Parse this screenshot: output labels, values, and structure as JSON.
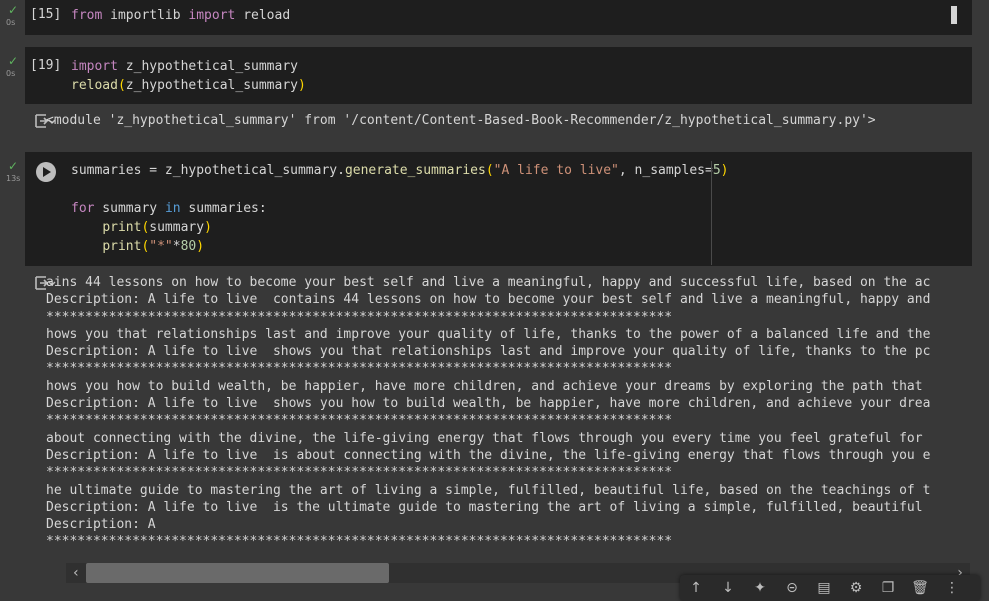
{
  "cells": [
    {
      "prompt": "[15]",
      "time": "0s",
      "lines": [
        [
          {
            "t": "from",
            "c": "kw"
          },
          {
            "t": " importlib ",
            "c": ""
          },
          {
            "t": "import",
            "c": "kw"
          },
          {
            "t": " reload",
            "c": ""
          }
        ]
      ]
    },
    {
      "prompt": "[19]",
      "time": "0s",
      "lines": [
        [
          {
            "t": "import",
            "c": "kw"
          },
          {
            "t": " z_hypothetical_summary",
            "c": ""
          }
        ],
        [
          {
            "t": "reload",
            "c": "fn"
          },
          {
            "t": "(",
            "c": "paren"
          },
          {
            "t": "z_hypothetical_summary",
            "c": ""
          },
          {
            "t": ")",
            "c": "paren"
          }
        ]
      ],
      "output": "<module 'z_hypothetical_summary' from '/content/Content-Based-Book-Recommender/z_hypothetical_summary.py'>"
    },
    {
      "time": "13s",
      "lines": [
        [
          {
            "t": "summaries = z_hypothetical_summary.",
            "c": ""
          },
          {
            "t": "generate_summaries",
            "c": "fn"
          },
          {
            "t": "(",
            "c": "paren"
          },
          {
            "t": "\"A life to live\"",
            "c": "str"
          },
          {
            "t": ", n_samples=",
            "c": ""
          },
          {
            "t": "5",
            "c": "num"
          },
          {
            "t": ")",
            "c": "paren"
          }
        ],
        [],
        [
          {
            "t": "for",
            "c": "kw"
          },
          {
            "t": " summary ",
            "c": ""
          },
          {
            "t": "in",
            "c": "kwb"
          },
          {
            "t": " summaries:",
            "c": ""
          }
        ],
        [
          {
            "t": "    ",
            "c": ""
          },
          {
            "t": "print",
            "c": "fn"
          },
          {
            "t": "(",
            "c": "paren"
          },
          {
            "t": "summary",
            "c": ""
          },
          {
            "t": ")",
            "c": "paren"
          }
        ],
        [
          {
            "t": "    ",
            "c": ""
          },
          {
            "t": "print",
            "c": "fn"
          },
          {
            "t": "(",
            "c": "paren"
          },
          {
            "t": "\"*\"",
            "c": "str"
          },
          {
            "t": "*",
            "c": ""
          },
          {
            "t": "80",
            "c": "num"
          },
          {
            "t": ")",
            "c": "paren"
          }
        ]
      ],
      "output_lines": [
        "ains 44 lessons on how to become your best self and live a meaningful, happy and successful life, based on the ac",
        "Description: A life to live  contains 44 lessons on how to become your best self and live a meaningful, happy and",
        "********************************************************************************",
        "hows you that relationships last and improve your quality of life, thanks to the power of a balanced life and the",
        "Description: A life to live  shows you that relationships last and improve your quality of life, thanks to the pc",
        "********************************************************************************",
        "hows you how to build wealth, be happier, have more children, and achieve your dreams by exploring the path that",
        "Description: A life to live  shows you how to build wealth, be happier, have more children, and achieve your drea",
        "********************************************************************************",
        "about connecting with the divine, the life-giving energy that flows through you every time you feel grateful for",
        "Description: A life to live  is about connecting with the divine, the life-giving energy that flows through you e",
        "********************************************************************************",
        "he ultimate guide to mastering the art of living a simple, fulfilled, beautiful life, based on the teachings of t",
        "Description: A life to live  is the ultimate guide to mastering the art of living a simple, fulfilled, beautiful",
        "Description: A",
        "********************************************************************************"
      ]
    }
  ],
  "colors": {
    "check": "#5fb35f",
    "code_bg": "#1e1e1e",
    "page_bg": "#383838"
  },
  "toolbar_icons": [
    "arrow-up-icon",
    "arrow-down-icon",
    "sparkle-icon",
    "link-icon",
    "comment-icon",
    "gear-icon",
    "copy-cell-icon",
    "delete-icon",
    "more-icon"
  ],
  "toolbar_glyphs": [
    "↑",
    "↓",
    "✦",
    "⊝",
    "▤",
    "⚙",
    "❐",
    "🗑",
    "⋮"
  ]
}
